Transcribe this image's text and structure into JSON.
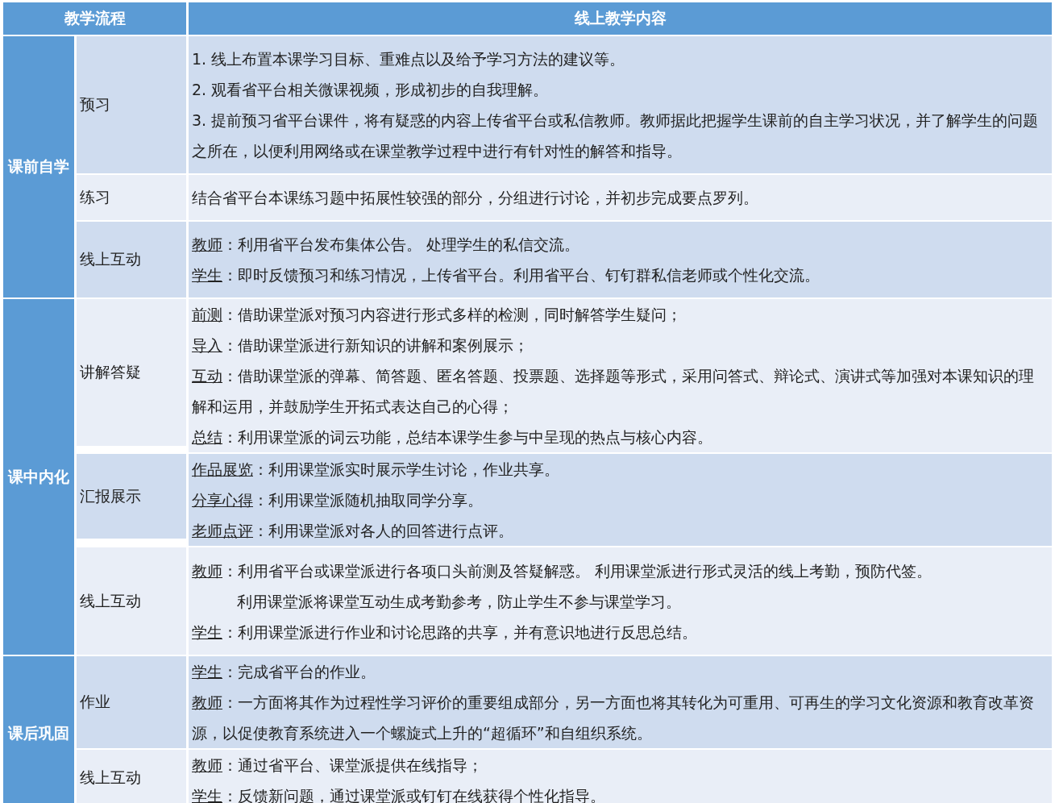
{
  "table": {
    "columns": [
      "教学流程",
      "线上教学内容"
    ],
    "sections": [
      {
        "stage": "课前自学",
        "rows": [
          {
            "step": "预习",
            "lines": [
              {
                "text": "1. 线上布置本课学习目标、重难点以及给予学习方法的建议等。"
              },
              {
                "text": "2. 观看省平台相关微课视频，形成初步的自我理解。"
              },
              {
                "text": "3. 提前预习省平台课件，将有疑惑的内容上传省平台或私信教师。教师据此把握学生课前的自主学习状况，并了解学生的问题之所在，以便利用网络或在课堂教学过程中进行有针对性的解答和指导。"
              }
            ]
          },
          {
            "step": "练习",
            "lines": [
              {
                "text": "结合省平台本课练习题中拓展性较强的部分，分组进行讨论，并初步完成要点罗列。"
              }
            ]
          },
          {
            "step": "线上互动",
            "lines": [
              {
                "label": "教师",
                "text": "：利用省平台发布集体公告。 处理学生的私信交流。"
              },
              {
                "label": "学生",
                "text": "：即时反馈预习和练习情况，上传省平台。利用省平台、钉钉群私信老师或个性化交流。"
              }
            ]
          }
        ]
      },
      {
        "stage": "课中内化",
        "rows": [
          {
            "step": "讲解答疑",
            "lines": [
              {
                "label": "前测",
                "text": "：借助课堂派对预习内容进行形式多样的检测，同时解答学生疑问；"
              },
              {
                "label": "导入",
                "text": "：借助课堂派进行新知识的讲解和案例展示；"
              },
              {
                "label": "互动",
                "text": "：借助课堂派的弹幕、简答题、匿名答题、投票题、选择题等形式，采用问答式、辩论式、演讲式等加强对本课知识的理解和运用，并鼓励学生开拓式表达自己的心得；"
              },
              {
                "label": "总结",
                "text": "：利用课堂派的词云功能，总结本课学生参与中呈现的热点与核心内容。"
              }
            ]
          },
          {
            "step": "汇报展示",
            "lines": [
              {
                "label": "作品展览",
                "text": "：利用课堂派实时展示学生讨论，作业共享。"
              },
              {
                "label": "分享心得",
                "text": "：利用课堂派随机抽取同学分享。"
              },
              {
                "label": "老师点评",
                "text": "：利用课堂派对各人的回答进行点评。"
              }
            ]
          },
          {
            "step": "线上互动",
            "lines": [
              {
                "label": "教师",
                "text": "：利用省平台或课堂派进行各项口头前测及答疑解惑。 利用课堂派进行形式灵活的线上考勤，预防代签。"
              },
              {
                "kind": "indent",
                "text": "利用课堂派将课堂互动生成考勤参考，防止学生不参与课堂学习。"
              },
              {
                "label": "学生",
                "text": "：利用课堂派进行作业和讨论思路的共享，并有意识地进行反思总结。"
              }
            ]
          }
        ]
      },
      {
        "stage": "课后巩固",
        "rows": [
          {
            "step": "作业",
            "lines": [
              {
                "label": "学生",
                "text": "：完成省平台的作业。"
              },
              {
                "label": "教师",
                "text": "：一方面将其作为过程性学习评价的重要组成部分，另一方面也将其转化为可重用、可再生的学习文化资源和教育改革资源，以促使教育系统进入一个螺旋式上升的“超循环”和自组织系统。"
              }
            ]
          },
          {
            "step": "线上互动",
            "lines": [
              {
                "label": "教师",
                "text": "：通过省平台、课堂派提供在线指导；"
              },
              {
                "label": "学生",
                "text": "：反馈新问题，通过课堂派或钉钉在线获得个性化指导。"
              }
            ]
          }
        ]
      }
    ]
  }
}
